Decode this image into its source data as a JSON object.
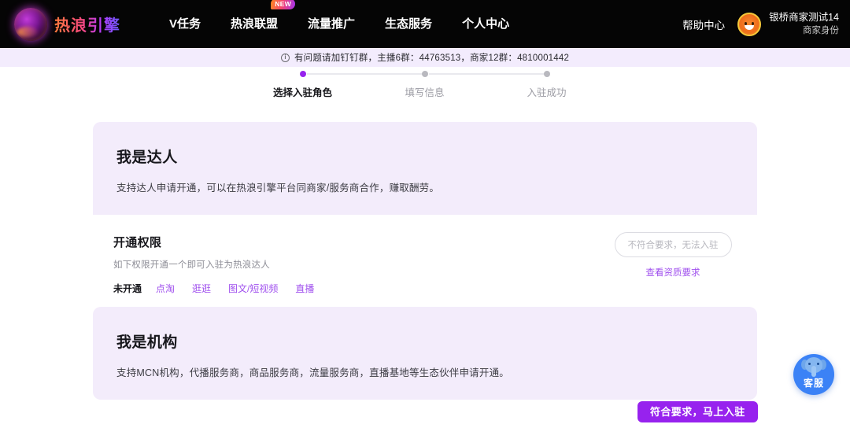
{
  "header": {
    "logo_text": "热浪引擎",
    "nav": [
      {
        "label": "V任务",
        "badge": ""
      },
      {
        "label": "热浪联盟",
        "badge": "NEW"
      },
      {
        "label": "流量推广",
        "badge": ""
      },
      {
        "label": "生态服务",
        "badge": ""
      },
      {
        "label": "个人中心",
        "badge": ""
      }
    ],
    "help": "帮助中心",
    "user_name": "银桥商家测试14",
    "user_role": "商家身份"
  },
  "notice": {
    "icon": "info-icon",
    "text": "有问题请加钉钉群，主播6群：44763513，商家12群：4810001442"
  },
  "stepper": {
    "steps": [
      {
        "label": "选择入驻角色",
        "active": true
      },
      {
        "label": "填写信息",
        "active": false
      },
      {
        "label": "入驻成功",
        "active": false
      }
    ]
  },
  "talent_card": {
    "title": "我是达人",
    "subtitle": "支持达人申请开通，可以在热浪引擎平台同商家/服务商合作，赚取酬劳。",
    "permission_title": "开通权限",
    "permission_desc": "如下权限开通一个即可入驻为热浪达人",
    "permission_state": "未开通",
    "permission_tags": [
      "点淘",
      "逛逛",
      "图文/短视频",
      "直播"
    ],
    "disabled_button": "不符合要求，无法入驻",
    "qualification_link": "查看资质要求"
  },
  "agency_card": {
    "title": "我是机构",
    "subtitle": "支持MCN机构，代播服务商，商品服务商，流量服务商，直播基地等生态伙伴申请开通。"
  },
  "footer": {
    "primary_button": "符合要求，马上入驻"
  },
  "service_widget": {
    "label": "客服",
    "icon": "elephant-mascot-icon"
  },
  "colors": {
    "accent": "#9722ee",
    "card_head_bg": "#f3ecfb",
    "notice_bg": "#f3ecfd",
    "topbar_bg": "#050505",
    "link": "#a050ee",
    "service_bg": "#3b82f6"
  }
}
